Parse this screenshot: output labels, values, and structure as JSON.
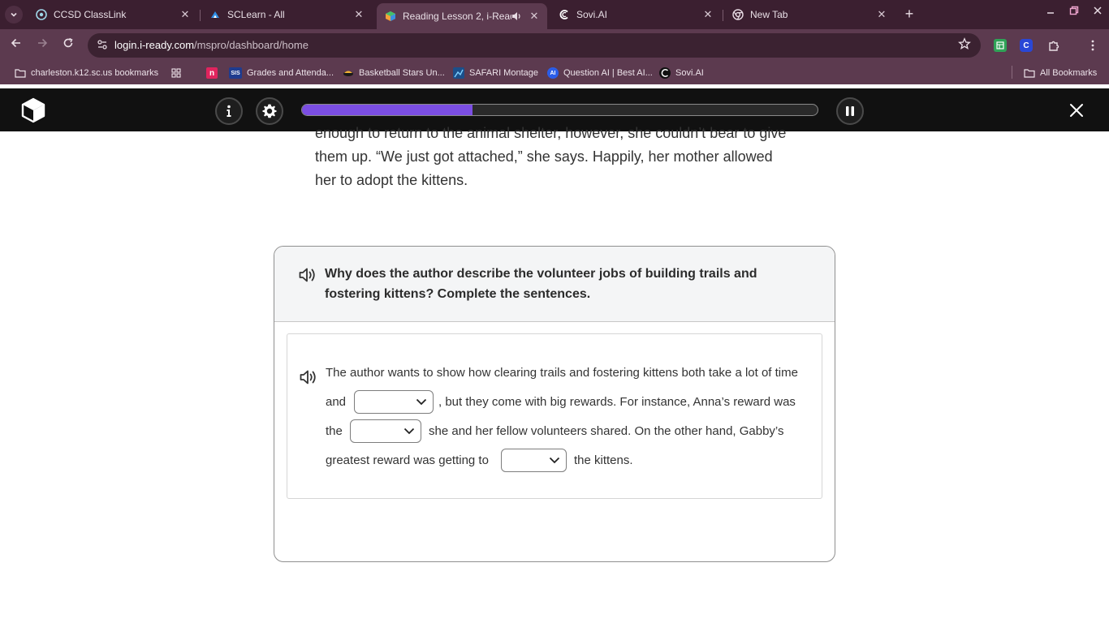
{
  "browser": {
    "tabs": [
      {
        "title": "CCSD ClassLink",
        "icon": "classlink-icon",
        "close": "✕"
      },
      {
        "title": "SCLearn - All",
        "icon": "sclearn-icon",
        "close": "✕"
      },
      {
        "title": "Reading Lesson 2, i-Ready",
        "icon": "iready-icon",
        "close": "✕",
        "active": true,
        "audio_icon": "speaker-icon"
      },
      {
        "title": "Sovi.AI",
        "icon": "sovi-icon",
        "close": "✕"
      },
      {
        "title": "New Tab",
        "icon": "chrome-icon",
        "close": "✕"
      }
    ],
    "new_tab": "+",
    "url_host": "login.i-ready.com",
    "url_path": "/mspro/dashboard/home",
    "bookmarks": [
      {
        "label": "charleston.k12.sc.us bookmarks",
        "icon": "folder-icon"
      },
      {
        "label": "",
        "icon": "apps-grid-icon"
      },
      {
        "label": "",
        "icon": "n-icon",
        "badge": "n"
      },
      {
        "label": "Grades and Attenda...",
        "icon": "sis-icon",
        "badge": "SIS"
      },
      {
        "label": "Basketball Stars Un...",
        "icon": "basketball-icon"
      },
      {
        "label": "SAFARI Montage",
        "icon": "safari-montage-icon"
      },
      {
        "label": "Question AI | Best AI...",
        "icon": "question-ai-icon",
        "badge": "AI"
      },
      {
        "label": "Sovi.AI",
        "icon": "sovi-icon"
      }
    ],
    "all_bookmarks": "All Bookmarks"
  },
  "app": {
    "progress": 0.33,
    "info_icon": "info-icon",
    "settings_icon": "gear-icon",
    "pause_icon": "pause-icon",
    "close_icon": "close-icon"
  },
  "passage": {
    "line1": "enough to return to the animal shelter, however, she couldn’t bear to give",
    "line2": "them up. “We just got attached,” she says. Happily, her mother allowed",
    "line3": "her to adopt the kittens."
  },
  "question": {
    "text": "Why does the author describe the volunteer jobs of building trails and fostering kittens? Complete the sentences."
  },
  "answer": {
    "l1": "The author wants to show how clearing trails and fostering kittens both take a lot of time",
    "l2a": "and",
    "l2b": ", but they come with big rewards. For instance, Anna’s reward was",
    "l3a": "the",
    "l3b": "she and her fellow volunteers shared. On the other hand, Gabby’s",
    "l4a": "greatest reward was getting to",
    "l4b": "the kittens.",
    "dropdown1": "",
    "dropdown2": "",
    "dropdown3": ""
  }
}
